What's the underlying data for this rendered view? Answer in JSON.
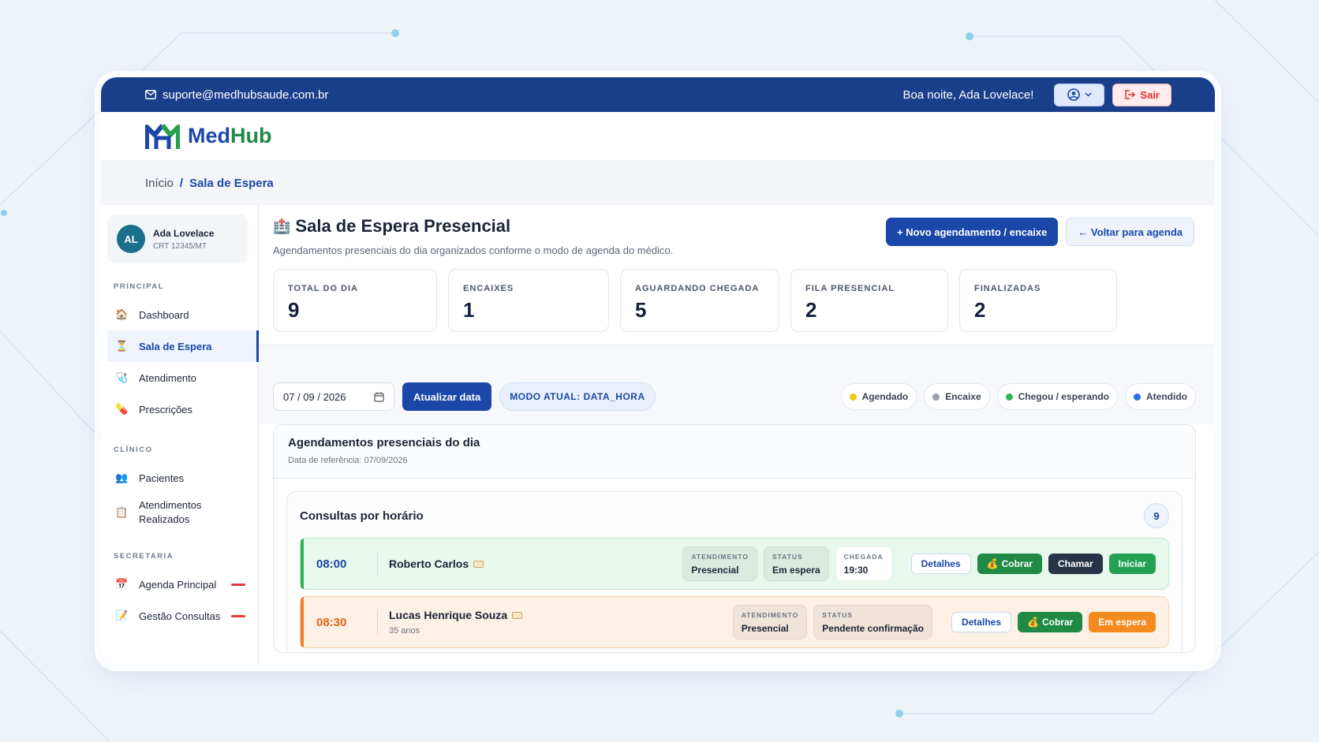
{
  "topbar": {
    "email": "suporte@medhubsaude.com.br",
    "greeting": "Boa noite, Ada Lovelace!",
    "logout_label": "Sair"
  },
  "brand": {
    "part1": "Med",
    "part2": "Hub"
  },
  "breadcrumb": {
    "home": "Início",
    "separator": "/",
    "current": "Sala de Espera"
  },
  "profile": {
    "initials": "AL",
    "name": "Ada Lovelace",
    "crt": "CRT 12345/MT"
  },
  "sidebar": {
    "sections": [
      {
        "title": "PRINCIPAL",
        "items": [
          {
            "label": "Dashboard",
            "icon": "house-icon"
          },
          {
            "label": "Sala de Espera",
            "icon": "hourglass-icon"
          },
          {
            "label": "Atendimento",
            "icon": "stethoscope-icon"
          },
          {
            "label": "Prescrições",
            "icon": "pill-icon"
          }
        ]
      },
      {
        "title": "CLÍNICO",
        "items": [
          {
            "label": "Pacientes",
            "icon": "users-icon"
          },
          {
            "label": "Atendimentos Realizados",
            "icon": "clipboard-icon"
          }
        ]
      },
      {
        "title": "SECRETARIA",
        "items": [
          {
            "label": "Agenda Principal",
            "icon": "calendar-icon"
          },
          {
            "label": "Gestão Consultas",
            "icon": "memo-icon"
          }
        ]
      }
    ]
  },
  "page": {
    "title": "Sala de Espera Presencial",
    "subtitle": "Agendamentos presenciais do dia organizados conforme o modo de agenda do médico.",
    "new_button": "+ Novo agendamento / encaixe",
    "back_button": "← Voltar para agenda"
  },
  "stats": [
    {
      "label": "TOTAL DO DIA",
      "value": "9"
    },
    {
      "label": "ENCAIXES",
      "value": "1"
    },
    {
      "label": "AGUARDANDO CHEGADA",
      "value": "5"
    },
    {
      "label": "FILA PRESENCIAL",
      "value": "2"
    },
    {
      "label": "FINALIZADAS",
      "value": "2"
    }
  ],
  "filters": {
    "date_value": "07 / 09 / 2026",
    "update_button": "Atualizar data",
    "mode_label": "MODO ATUAL: DATA_HORA"
  },
  "legend": [
    {
      "label": "Agendado",
      "color": "#f5c518"
    },
    {
      "label": "Encaixe",
      "color": "#9aa0a8"
    },
    {
      "label": "Chegou / esperando",
      "color": "#2fb35a"
    },
    {
      "label": "Atendido",
      "color": "#2f6fe0"
    }
  ],
  "panel": {
    "title": "Agendamentos presenciais do dia",
    "reference": "Data de referência: 07/09/2026",
    "inner_title": "Consultas por horário",
    "count": "9"
  },
  "appointments": [
    {
      "time": "08:00",
      "name": "Roberto Carlos",
      "age": "",
      "chips": [
        {
          "key": "ATENDIMENTO",
          "value": "Presencial"
        },
        {
          "key": "STATUS",
          "value": "Em espera"
        },
        {
          "key": "CHEGADA",
          "value": "19:30"
        }
      ],
      "actions": {
        "details": "Detalhes",
        "charge": "Cobrar",
        "call": "Chamar",
        "start": "Iniciar"
      }
    },
    {
      "time": "08:30",
      "name": "Lucas Henrique Souza",
      "age": "35 anos",
      "chips": [
        {
          "key": "ATENDIMENTO",
          "value": "Presencial"
        },
        {
          "key": "STATUS",
          "value": "Pendente confirmação"
        }
      ],
      "actions": {
        "details": "Detalhes",
        "charge": "Cobrar",
        "waiting": "Em espera"
      }
    }
  ]
}
